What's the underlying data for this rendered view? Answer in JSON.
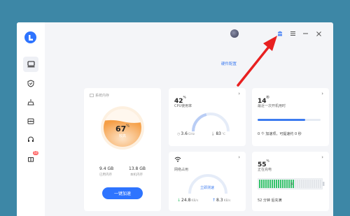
{
  "window": {
    "hw_config_link": "硬件配置"
  },
  "sidebar": {
    "items": [
      {
        "icon": "computer-icon"
      },
      {
        "icon": "shield-icon"
      },
      {
        "icon": "broom-icon"
      },
      {
        "icon": "toolbox-icon"
      },
      {
        "icon": "headset-icon"
      },
      {
        "icon": "gift-icon",
        "badge": "10"
      }
    ]
  },
  "memory": {
    "title": "系统内存",
    "percent": "67",
    "percent_unit": "%",
    "status": "较高",
    "used_value": "9.4 GB",
    "used_label": "已用内存",
    "total_value": "13.8 GB",
    "total_label": "本机内存",
    "button": "一键加速",
    "fill": 0.67
  },
  "cpu": {
    "percent": "42",
    "percent_unit": "%",
    "label": "CPU使用率",
    "freq": "3.6",
    "freq_unit": "GHz",
    "temp": "83",
    "temp_unit": "℃",
    "level": 0.42
  },
  "boot": {
    "time": "14",
    "time_unit": "秒",
    "label": "最近一次开机用时",
    "items_text": "0 个 加速项，可提速约 0 秒",
    "progress": 0.75
  },
  "network": {
    "label": "网络占用",
    "test_button": "立即测速",
    "down": "24.8",
    "down_unit": "KB/s",
    "up": "8.3",
    "up_unit": "KB/s"
  },
  "battery": {
    "percent": "55",
    "percent_unit": "%",
    "status": "正在充电",
    "remaining": "52 分钟 后充满",
    "level": 0.55
  },
  "colors": {
    "accent": "#2e74ff",
    "orange": "#f5a24b",
    "green": "#35c36b",
    "background": "#3d87a6",
    "arrow": "#e82020"
  }
}
